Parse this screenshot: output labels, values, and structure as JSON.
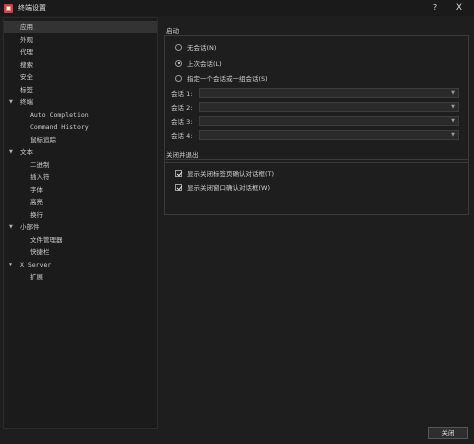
{
  "window": {
    "title": "终端设置",
    "help_label": "?",
    "close_label": "X"
  },
  "sidebar": {
    "items": [
      {
        "label": "应用",
        "level": 0,
        "arrow": "",
        "selected": true
      },
      {
        "label": "外观",
        "level": 0,
        "arrow": ""
      },
      {
        "label": "代理",
        "level": 0,
        "arrow": ""
      },
      {
        "label": "搜索",
        "level": 0,
        "arrow": ""
      },
      {
        "label": "安全",
        "level": 0,
        "arrow": ""
      },
      {
        "label": "标签",
        "level": 0,
        "arrow": ""
      },
      {
        "label": "终端",
        "level": 0,
        "arrow": "▼"
      },
      {
        "label": "Auto Completion",
        "level": 1,
        "arrow": ""
      },
      {
        "label": "Command History",
        "level": 1,
        "arrow": ""
      },
      {
        "label": "鼠标追踪",
        "level": 1,
        "arrow": ""
      },
      {
        "label": "文本",
        "level": 0,
        "arrow": "▼"
      },
      {
        "label": "二进制",
        "level": 1,
        "arrow": ""
      },
      {
        "label": "插入符",
        "level": 1,
        "arrow": ""
      },
      {
        "label": "字体",
        "level": 1,
        "arrow": ""
      },
      {
        "label": "高亮",
        "level": 1,
        "arrow": ""
      },
      {
        "label": "换行",
        "level": 1,
        "arrow": ""
      },
      {
        "label": "小部件",
        "level": 0,
        "arrow": "▼"
      },
      {
        "label": "文件管理器",
        "level": 1,
        "arrow": ""
      },
      {
        "label": "快捷栏",
        "level": 1,
        "arrow": ""
      },
      {
        "label": "X Server",
        "level": 0,
        "arrow": "▼"
      },
      {
        "label": "扩展",
        "level": 1,
        "arrow": ""
      }
    ]
  },
  "startup": {
    "title": "启动",
    "options": [
      {
        "label": "无会话(N)",
        "checked": false
      },
      {
        "label": "上次会话(L)",
        "checked": true
      },
      {
        "label": "指定一个会话或一组会话(S)",
        "checked": false
      }
    ],
    "sessions": [
      {
        "label": "会话 1:",
        "value": ""
      },
      {
        "label": "会话 2:",
        "value": ""
      },
      {
        "label": "会话 3:",
        "value": ""
      },
      {
        "label": "会话 4:",
        "value": ""
      }
    ]
  },
  "shutdown": {
    "title": "关闭并退出",
    "options": [
      {
        "label": "显示关闭标签页确认对话框(T)",
        "checked": true
      },
      {
        "label": "显示关闭窗口确认对话框(W)",
        "checked": true
      }
    ]
  },
  "footer": {
    "close_label": "关闭"
  }
}
